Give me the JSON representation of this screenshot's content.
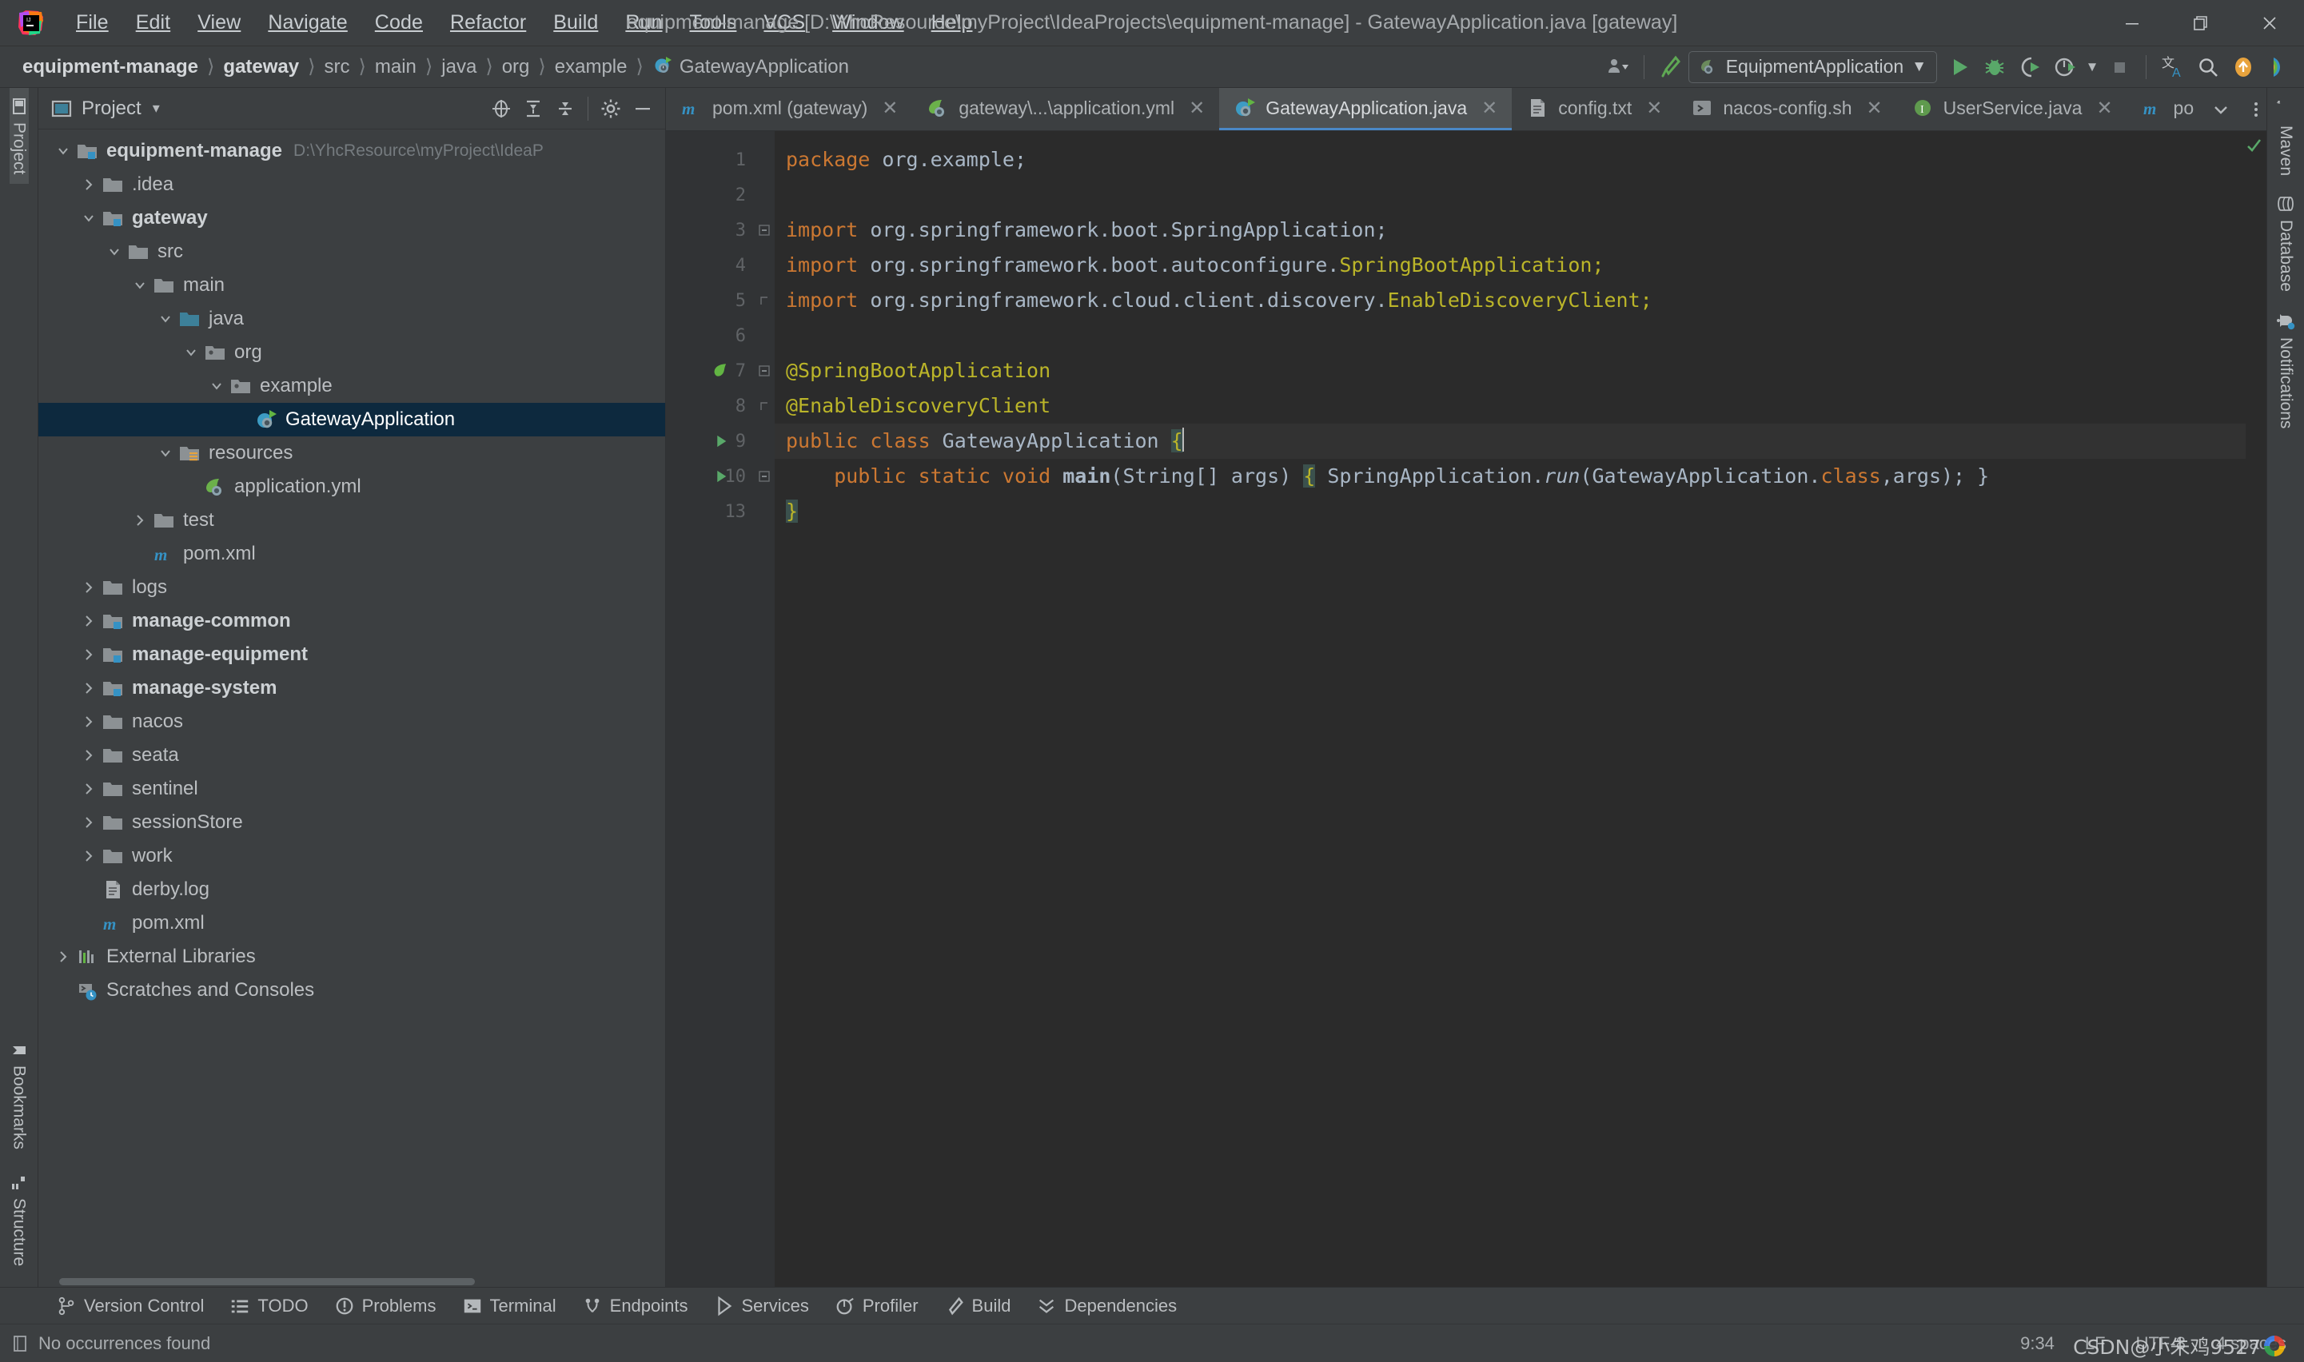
{
  "window": {
    "title": "equipment-manage [D:\\YhcResource\\myProject\\IdeaProjects\\equipment-manage] - GatewayApplication.java [gateway]",
    "minimize_label": "–",
    "restore_label": "❐",
    "close_label": "✕"
  },
  "menu": [
    {
      "label": "File"
    },
    {
      "label": "Edit"
    },
    {
      "label": "View"
    },
    {
      "label": "Navigate"
    },
    {
      "label": "Code"
    },
    {
      "label": "Refactor"
    },
    {
      "label": "Build"
    },
    {
      "label": "Run"
    },
    {
      "label": "Tools"
    },
    {
      "label": "VCS"
    },
    {
      "label": "Window"
    },
    {
      "label": "Help"
    }
  ],
  "breadcrumb": [
    {
      "label": "equipment-manage",
      "bold": true
    },
    {
      "label": "gateway",
      "bold": true
    },
    {
      "label": "src",
      "bold": false
    },
    {
      "label": "main",
      "bold": false
    },
    {
      "label": "java",
      "bold": false
    },
    {
      "label": "org",
      "bold": false
    },
    {
      "label": "example",
      "bold": false
    },
    {
      "label": "GatewayApplication",
      "bold": false,
      "icon": "spring-class-icon"
    }
  ],
  "toolbar": {
    "run_configuration": "EquipmentApplication",
    "icons": [
      "user-settings-icon",
      "build-hammer-icon",
      "run-icon",
      "debug-icon",
      "run-with-coverage-icon",
      "profiler-icon",
      "stop-icon",
      "translate-icon",
      "search-everywhere-icon",
      "updates-icon",
      "ide-feature-icon"
    ]
  },
  "left_stripe": [
    {
      "label": "Project",
      "icon": "project-icon",
      "active": true
    },
    {
      "label": "Bookmarks",
      "icon": "bookmarks-icon",
      "active": false
    },
    {
      "label": "Structure",
      "icon": "structure-icon",
      "active": false
    }
  ],
  "right_stripe": [
    {
      "label": "Maven",
      "icon": "maven-icon"
    },
    {
      "label": "Database",
      "icon": "database-icon"
    },
    {
      "label": "Notifications",
      "icon": "notifications-icon"
    }
  ],
  "project_panel": {
    "title": "Project",
    "dropdown": "▾",
    "actions": [
      "locate-icon",
      "expand-all-icon",
      "collapse-all-icon",
      "settings-gear-icon",
      "hide-icon"
    ],
    "tree": [
      {
        "label": "equipment-manage",
        "hint": "D:\\YhcResource\\myProject\\IdeaP",
        "depth": 0,
        "arrow": "down",
        "icon": "module-root-icon",
        "bold": true,
        "selected": false
      },
      {
        "label": ".idea",
        "hint": "",
        "depth": 1,
        "arrow": "right",
        "icon": "folder-icon",
        "bold": false,
        "selected": false
      },
      {
        "label": "gateway",
        "hint": "",
        "depth": 1,
        "arrow": "down",
        "icon": "module-icon",
        "bold": true,
        "selected": false
      },
      {
        "label": "src",
        "hint": "",
        "depth": 2,
        "arrow": "down",
        "icon": "folder-icon",
        "bold": false,
        "selected": false
      },
      {
        "label": "main",
        "hint": "",
        "depth": 3,
        "arrow": "down",
        "icon": "folder-icon",
        "bold": false,
        "selected": false
      },
      {
        "label": "java",
        "hint": "",
        "depth": 4,
        "arrow": "down",
        "icon": "source-folder-icon",
        "bold": false,
        "selected": false
      },
      {
        "label": "org",
        "hint": "",
        "depth": 5,
        "arrow": "down",
        "icon": "package-icon",
        "bold": false,
        "selected": false
      },
      {
        "label": "example",
        "hint": "",
        "depth": 6,
        "arrow": "down",
        "icon": "package-icon",
        "bold": false,
        "selected": false
      },
      {
        "label": "GatewayApplication",
        "hint": "",
        "depth": 7,
        "arrow": "none",
        "icon": "spring-class-icon",
        "bold": false,
        "selected": true
      },
      {
        "label": "resources",
        "hint": "",
        "depth": 4,
        "arrow": "down",
        "icon": "resources-folder-icon",
        "bold": false,
        "selected": false
      },
      {
        "label": "application.yml",
        "hint": "",
        "depth": 5,
        "arrow": "none",
        "icon": "spring-yml-icon",
        "bold": false,
        "selected": false
      },
      {
        "label": "test",
        "hint": "",
        "depth": 3,
        "arrow": "right",
        "icon": "folder-icon",
        "bold": false,
        "selected": false
      },
      {
        "label": "pom.xml",
        "hint": "",
        "depth": 3,
        "arrow": "none",
        "icon": "maven-icon",
        "bold": false,
        "selected": false
      },
      {
        "label": "logs",
        "hint": "",
        "depth": 1,
        "arrow": "right",
        "icon": "folder-icon",
        "bold": false,
        "selected": false
      },
      {
        "label": "manage-common",
        "hint": "",
        "depth": 1,
        "arrow": "right",
        "icon": "module-icon",
        "bold": true,
        "selected": false
      },
      {
        "label": "manage-equipment",
        "hint": "",
        "depth": 1,
        "arrow": "right",
        "icon": "module-icon",
        "bold": true,
        "selected": false
      },
      {
        "label": "manage-system",
        "hint": "",
        "depth": 1,
        "arrow": "right",
        "icon": "module-icon",
        "bold": true,
        "selected": false
      },
      {
        "label": "nacos",
        "hint": "",
        "depth": 1,
        "arrow": "right",
        "icon": "folder-icon",
        "bold": false,
        "selected": false
      },
      {
        "label": "seata",
        "hint": "",
        "depth": 1,
        "arrow": "right",
        "icon": "folder-icon",
        "bold": false,
        "selected": false
      },
      {
        "label": "sentinel",
        "hint": "",
        "depth": 1,
        "arrow": "right",
        "icon": "folder-icon",
        "bold": false,
        "selected": false
      },
      {
        "label": "sessionStore",
        "hint": "",
        "depth": 1,
        "arrow": "right",
        "icon": "folder-icon",
        "bold": false,
        "selected": false
      },
      {
        "label": "work",
        "hint": "",
        "depth": 1,
        "arrow": "right",
        "icon": "folder-icon",
        "bold": false,
        "selected": false
      },
      {
        "label": "derby.log",
        "hint": "",
        "depth": 1,
        "arrow": "none",
        "icon": "text-file-icon",
        "bold": false,
        "selected": false
      },
      {
        "label": "pom.xml",
        "hint": "",
        "depth": 1,
        "arrow": "none",
        "icon": "maven-icon",
        "bold": false,
        "selected": false
      },
      {
        "label": "External Libraries",
        "hint": "",
        "depth": 0,
        "arrow": "right",
        "icon": "libraries-icon",
        "bold": false,
        "selected": false
      },
      {
        "label": "Scratches and Consoles",
        "hint": "",
        "depth": 0,
        "arrow": "none",
        "icon": "scratches-icon",
        "bold": false,
        "selected": false
      }
    ]
  },
  "editor_tabs": [
    {
      "label": "pom.xml (gateway)",
      "icon": "maven-icon",
      "active": false,
      "closable": true
    },
    {
      "label": "gateway\\...\\application.yml",
      "icon": "spring-yml-icon",
      "active": false,
      "closable": true
    },
    {
      "label": "GatewayApplication.java",
      "icon": "spring-class-icon",
      "active": true,
      "closable": true
    },
    {
      "label": "config.txt",
      "icon": "text-file-icon",
      "active": false,
      "closable": true
    },
    {
      "label": "nacos-config.sh",
      "icon": "shell-script-icon",
      "active": false,
      "closable": true
    },
    {
      "label": "UserService.java",
      "icon": "java-interface-icon",
      "active": false,
      "closable": true
    },
    {
      "label": "po",
      "icon": "maven-icon",
      "active": false,
      "closable": false
    }
  ],
  "tabbar_actions": [
    "chevron-down-icon",
    "more-vertical-icon"
  ],
  "editor": {
    "line_numbers": [
      "1",
      "2",
      "3",
      "4",
      "5",
      "6",
      "7",
      "8",
      "9",
      "10",
      "13"
    ],
    "lines": [
      {
        "n": "1",
        "tokens": [
          {
            "t": "package ",
            "c": "k"
          },
          {
            "t": "org.example;",
            "c": "s"
          }
        ]
      },
      {
        "n": "2",
        "tokens": []
      },
      {
        "n": "3",
        "tokens": [
          {
            "t": "import ",
            "c": "k"
          },
          {
            "t": "org.springframework.boot.SpringApplication;",
            "c": "s"
          }
        ]
      },
      {
        "n": "4",
        "tokens": [
          {
            "t": "import ",
            "c": "k"
          },
          {
            "t": "org.springframework.boot.autoconfigure.",
            "c": "s"
          },
          {
            "t": "SpringBootApplication;",
            "c": "ann"
          }
        ]
      },
      {
        "n": "5",
        "tokens": [
          {
            "t": "import ",
            "c": "k"
          },
          {
            "t": "org.springframework.cloud.client.discovery.",
            "c": "s"
          },
          {
            "t": "EnableDiscoveryClient;",
            "c": "ann"
          }
        ]
      },
      {
        "n": "6",
        "tokens": []
      },
      {
        "n": "7",
        "tokens": [
          {
            "t": "@SpringBootApplication",
            "c": "ann"
          }
        ]
      },
      {
        "n": "8",
        "tokens": [
          {
            "t": "@EnableDiscoveryClient",
            "c": "ann"
          }
        ]
      },
      {
        "n": "9",
        "tokens": [
          {
            "t": "public class ",
            "c": "k"
          },
          {
            "t": "GatewayApplication ",
            "c": "s"
          },
          {
            "t": "{",
            "c": "brmatch"
          }
        ]
      },
      {
        "n": "10",
        "tokens": [
          {
            "t": "    public static void ",
            "c": "k"
          },
          {
            "t": "main",
            "c": "b"
          },
          {
            "t": "(String[] args) ",
            "c": "s"
          },
          {
            "t": "{",
            "c": "brhl"
          },
          {
            "t": " SpringApplication.",
            "c": "s"
          },
          {
            "t": "run",
            "c": "it"
          },
          {
            "t": "(GatewayApplication.",
            "c": "s"
          },
          {
            "t": "class",
            "c": "k"
          },
          {
            "t": ",args); }",
            "c": "s"
          }
        ]
      },
      {
        "n": "13",
        "tokens": [
          {
            "t": "}",
            "c": "brmatch"
          }
        ]
      }
    ],
    "gutter_marks": {
      "7": "spring-bean-icon",
      "9": "run-gutter-icon",
      "10": "run-gutter-icon"
    },
    "inspection_status": "ok-check-icon"
  },
  "bottom_tool_window": [
    {
      "label": "Version Control",
      "icon": "branch-icon"
    },
    {
      "label": "TODO",
      "icon": "todo-icon"
    },
    {
      "label": "Problems",
      "icon": "problems-icon"
    },
    {
      "label": "Terminal",
      "icon": "terminal-icon"
    },
    {
      "label": "Endpoints",
      "icon": "endpoints-icon"
    },
    {
      "label": "Services",
      "icon": "services-icon"
    },
    {
      "label": "Profiler",
      "icon": "profiler-icon"
    },
    {
      "label": "Build",
      "icon": "build-icon"
    },
    {
      "label": "Dependencies",
      "icon": "dependencies-icon"
    }
  ],
  "status_bar": {
    "message": "No occurrences found",
    "message_icon": "info-icon",
    "caret_position": "9:34",
    "line_separator": "LF",
    "encoding": "UTF-8",
    "indent": "4 spaces"
  },
  "watermark": {
    "text": "CSDN@小朱鸡9527"
  },
  "colors": {
    "accent_blue": "#4a88c7",
    "selection_bg": "#0d293e",
    "editor_bg": "#2b2b2b",
    "chrome_bg": "#3c3f41",
    "keyword_orange": "#cc7832",
    "annotation_yellow": "#bbb529",
    "text_default": "#a9b7c6"
  }
}
